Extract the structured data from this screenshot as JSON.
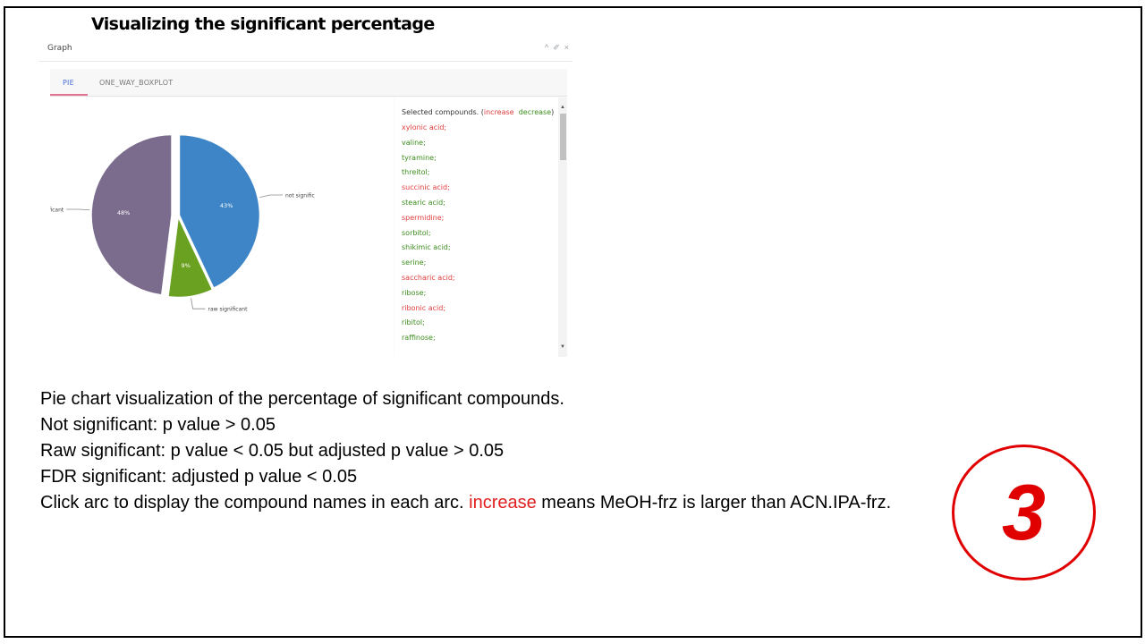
{
  "slide": {
    "title": "Visualizing the significant percentage",
    "step_number": "3"
  },
  "widget": {
    "title": "Graph",
    "controls": {
      "collapse": "^",
      "settings": "✐",
      "close": "×"
    },
    "tabs": [
      {
        "label": "PIE",
        "active": true
      },
      {
        "label": "ONE_WAY_BOXPLOT",
        "active": false
      }
    ],
    "list": {
      "header_prefix": "Selected compounds. (",
      "increase_label": "increase",
      "decrease_label": "decrease",
      "header_suffix": ")",
      "compounds": [
        {
          "name": "xylonic acid;",
          "direction": "increase"
        },
        {
          "name": "valine;",
          "direction": "decrease"
        },
        {
          "name": "tyramine;",
          "direction": "decrease"
        },
        {
          "name": "threitol;",
          "direction": "decrease"
        },
        {
          "name": "succinic acid;",
          "direction": "increase"
        },
        {
          "name": "stearic acid;",
          "direction": "decrease"
        },
        {
          "name": "spermidine;",
          "direction": "increase"
        },
        {
          "name": "sorbitol;",
          "direction": "decrease"
        },
        {
          "name": "shikimic acid;",
          "direction": "decrease"
        },
        {
          "name": "serine;",
          "direction": "decrease"
        },
        {
          "name": "saccharic acid;",
          "direction": "increase"
        },
        {
          "name": "ribose;",
          "direction": "decrease"
        },
        {
          "name": "ribonic acid;",
          "direction": "increase"
        },
        {
          "name": "ribitol;",
          "direction": "decrease"
        },
        {
          "name": "raffinose;",
          "direction": "decrease"
        }
      ],
      "scroll_up": "▲",
      "scroll_down": "▼"
    }
  },
  "chart_data": {
    "type": "pie",
    "slices": [
      {
        "label": "not signific",
        "value": 43,
        "data_label": "43%",
        "color": "#3d85c6",
        "exploded": false
      },
      {
        "label": "raw significant",
        "value": 9,
        "data_label": "9%",
        "color": "#6aa121",
        "exploded": false
      },
      {
        "label": "ignificant",
        "value": 48,
        "data_label": "48%",
        "color": "#7b6b8d",
        "exploded": true
      }
    ]
  },
  "caption": {
    "line1": "Pie chart visualization of the percentage of significant compounds.",
    "line2": "Not significant: p value > 0.05",
    "line3": "Raw significant: p value < 0.05 but adjusted p value > 0.05",
    "line4": "FDR significant: adjusted p value < 0.05",
    "line5_a": "Click arc to display the compound names in each arc. ",
    "line5_red": "increase",
    "line5_b": " means MeOH-frz is larger than ACN.IPA-frz."
  },
  "colors": {
    "increase": "#e03c3c",
    "decrease": "#3c8c1e",
    "accent_tab": "#4a6fd8",
    "badge_red": "#e00000"
  }
}
